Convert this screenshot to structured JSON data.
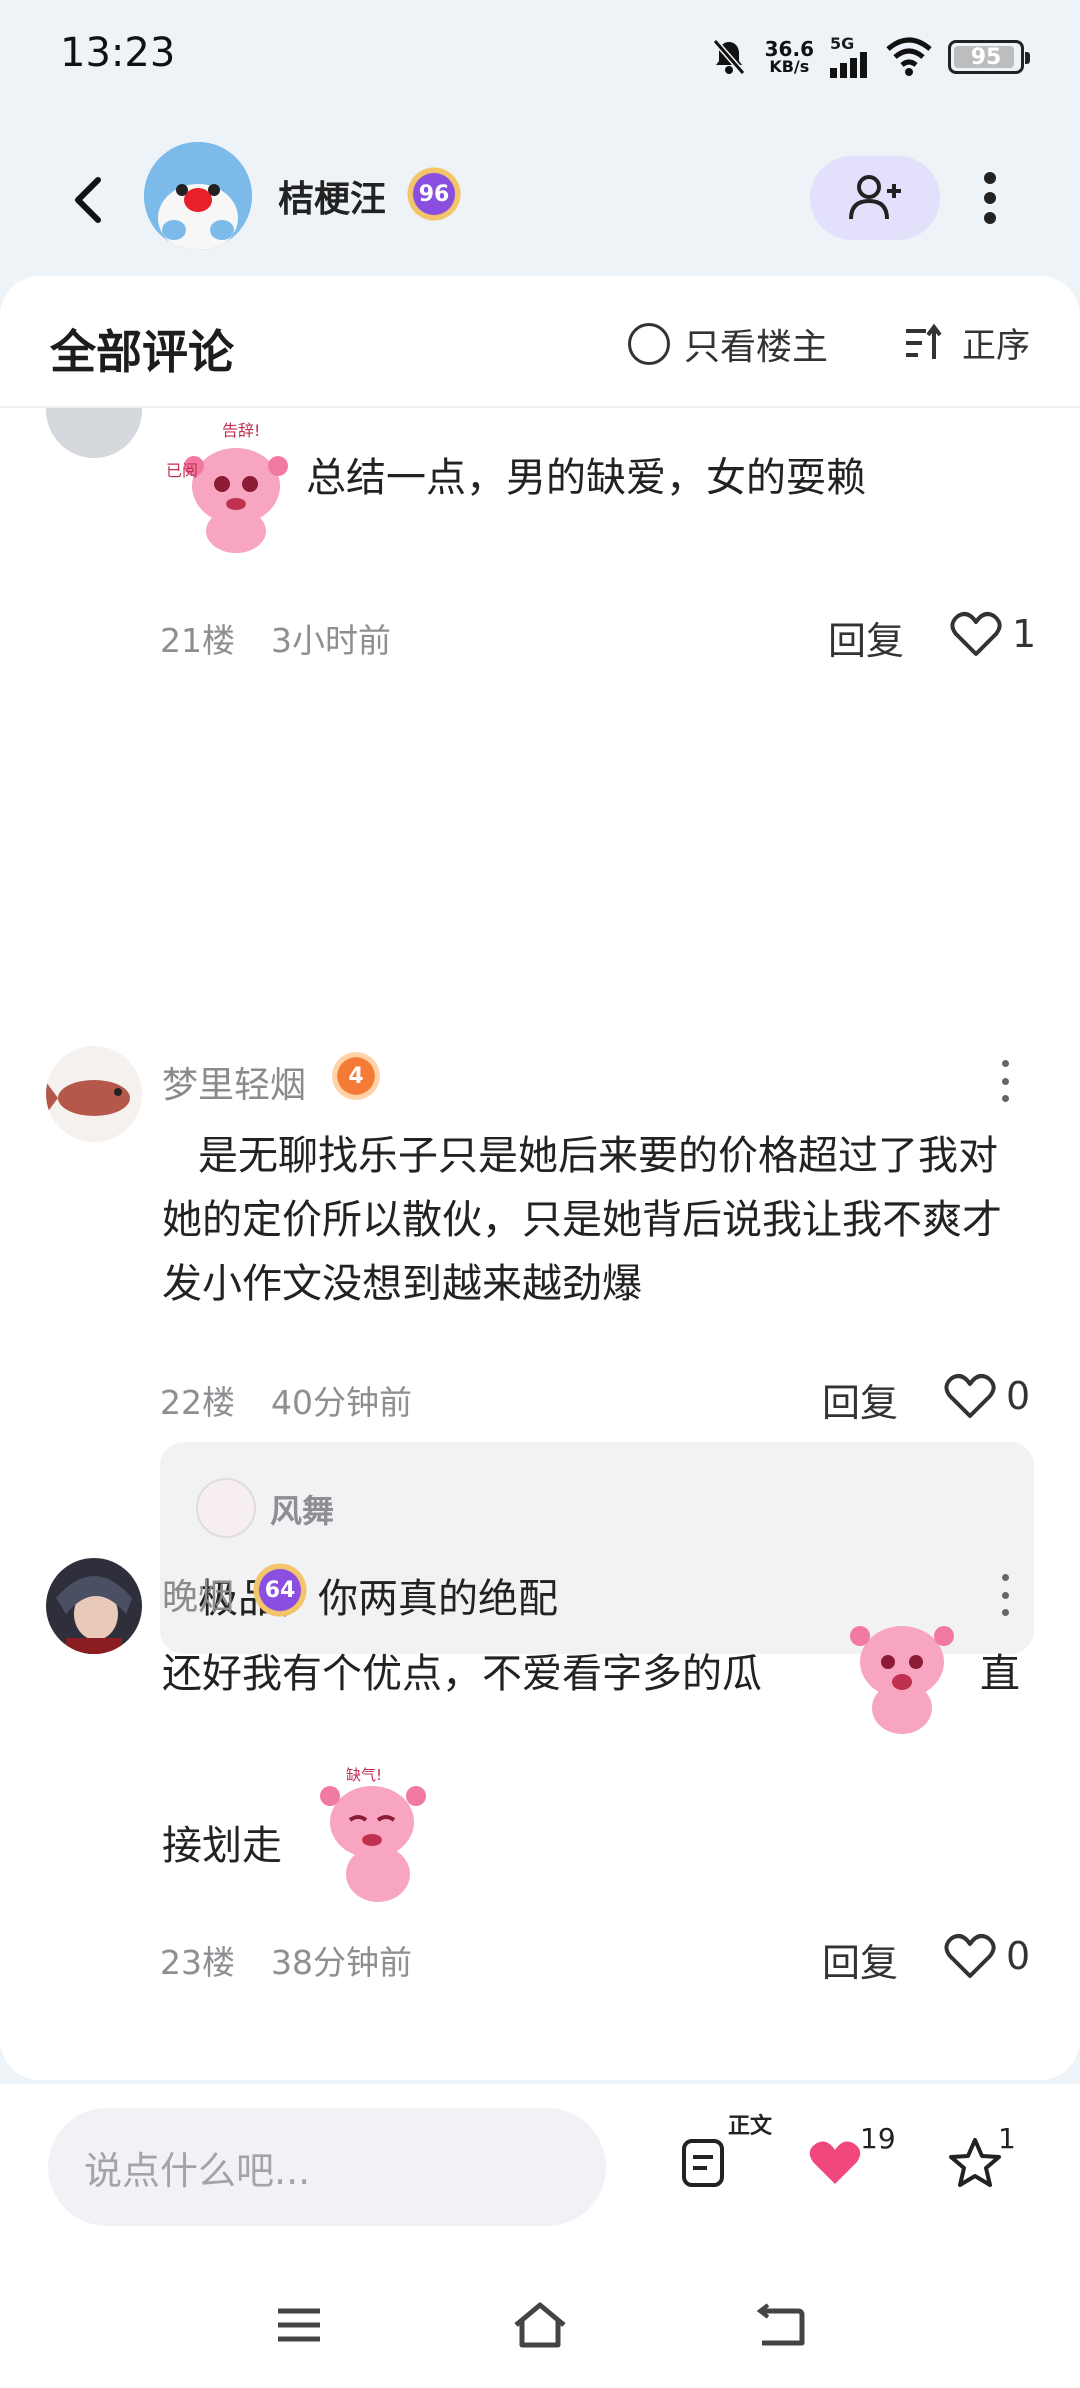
{
  "status_bar": {
    "time": "13:23",
    "net_speed_value": "36.6",
    "net_speed_unit": "KB/s",
    "network": "5G",
    "battery": "95"
  },
  "post_author": {
    "name": "桔梗汪",
    "level": "96"
  },
  "comments_header": {
    "title": "全部评论",
    "only_author_label": "只看楼主",
    "sort_label": "正序"
  },
  "comments": [
    {
      "text": "总结一点，男的缺爱，女的耍赖",
      "floor": "21楼",
      "time": "3小时前",
      "reply_label": "回复",
      "likes": "1"
    },
    {
      "name": "梦里轻烟",
      "level": "4",
      "text": "是无聊找乐子只是她后来要的价格超过了我对她的定价所以散伙，只是她背后说我让我不爽才发小作文没想到越来越劲爆",
      "floor": "22楼",
      "time": "40分钟前",
      "reply_label": "回复",
      "likes": "0",
      "sub_reply": {
        "name": "风舞",
        "text": "极品，你两真的绝配"
      }
    },
    {
      "name": "晚烟",
      "level": "64",
      "text_part1": "还好我有个优点，不爱看字多的瓜",
      "text_part2": "直",
      "text_part3": "接划走",
      "floor": "23楼",
      "time": "38分钟前",
      "reply_label": "回复",
      "likes": "0"
    }
  ],
  "stickers": {
    "sticker1_caption_a": "告辞!",
    "sticker1_caption_b": "已阅",
    "sticker3_caption": "缺气!"
  },
  "bottom_bar": {
    "input_placeholder": "说点什么吧...",
    "article_badge": "正文",
    "like_count": "19",
    "favorite_count": "1"
  },
  "colors": {
    "accent_purple": "#8a4ee0",
    "like_pink": "#f0487c",
    "follow_bg": "#e2e0fb"
  }
}
